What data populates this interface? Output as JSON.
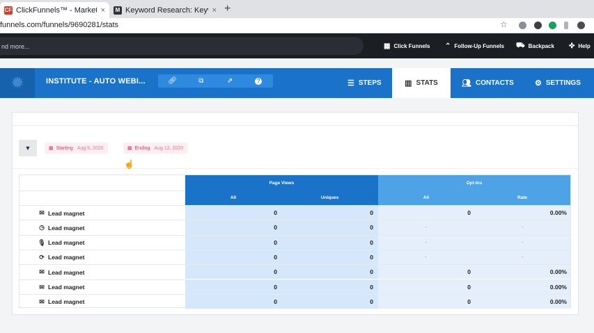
{
  "browser": {
    "tabs": [
      {
        "title": "ClickFunnels™ - Marketing Fu",
        "close": "×"
      },
      {
        "title": "Keyword Research: Keyword S",
        "close": "×"
      }
    ],
    "new_tab": "+",
    "url": "funnels.com/funnels/9690281/stats"
  },
  "topbar": {
    "search_text": "nd more...",
    "links": [
      {
        "label": "Click Funnels",
        "icon": "clickfunnels-icon"
      },
      {
        "label": "Follow-Up Funnels",
        "icon": "double-chevron-up-icon"
      },
      {
        "label": "Backpack",
        "icon": "backpack-icon"
      },
      {
        "label": "Help",
        "icon": "lifebuoy-icon"
      }
    ]
  },
  "funnel": {
    "name": "INSTITUTE - AUTO WEBI...",
    "icon_buttons": [
      "link-icon",
      "copy-icon",
      "external-link-icon",
      "question-icon"
    ],
    "nav": [
      {
        "label": "STEPS",
        "icon": "list-icon"
      },
      {
        "label": "STATS",
        "icon": "bar-chart-icon",
        "active": true
      },
      {
        "label": "CONTACTS",
        "icon": "users-icon"
      },
      {
        "label": "SETTINGS",
        "icon": "gear-icon"
      }
    ]
  },
  "filters": {
    "starting_label": "Starting",
    "starting_value": "Aug 5, 2020",
    "ending_label": "Ending",
    "ending_value": "Aug 12, 2020"
  },
  "stats_table": {
    "groups": [
      "Page Views",
      "Opt-Ins"
    ],
    "columns": [
      "All",
      "Uniques",
      "All",
      "Rate"
    ],
    "rows": [
      {
        "icon": "envelope-outline-icon",
        "label": "Lead magnet",
        "pv_all": "0",
        "pv_uniques": "0",
        "oi_all": "0",
        "oi_rate": "0.00%"
      },
      {
        "icon": "clock-icon",
        "label": "Lead magnet",
        "pv_all": "0",
        "pv_uniques": "0",
        "oi_all": "-",
        "oi_rate": "-"
      },
      {
        "icon": "microphone-icon",
        "label": "Lead magnet",
        "pv_all": "0",
        "pv_uniques": "0",
        "oi_all": "-",
        "oi_rate": "-"
      },
      {
        "icon": "refresh-icon",
        "label": "Lead magnet",
        "pv_all": "0",
        "pv_uniques": "0",
        "oi_all": "-",
        "oi_rate": "-"
      },
      {
        "icon": "envelope-icon",
        "label": "Lead magnet",
        "pv_all": "0",
        "pv_uniques": "0",
        "oi_all": "0",
        "oi_rate": "0.00%"
      },
      {
        "icon": "envelope-icon",
        "label": "Lead magnet",
        "pv_all": "0",
        "pv_uniques": "0",
        "oi_all": "0",
        "oi_rate": "0.00%"
      },
      {
        "icon": "envelope-icon",
        "label": "Lead magnet",
        "pv_all": "0",
        "pv_uniques": "0",
        "oi_all": "0",
        "oi_rate": "0.00%"
      }
    ]
  },
  "colors": {
    "brand_blue": "#1a73c8",
    "page_views_header": "#1a73c8",
    "optins_header": "#4ea3e6",
    "date_chip": "#fdeef2"
  }
}
